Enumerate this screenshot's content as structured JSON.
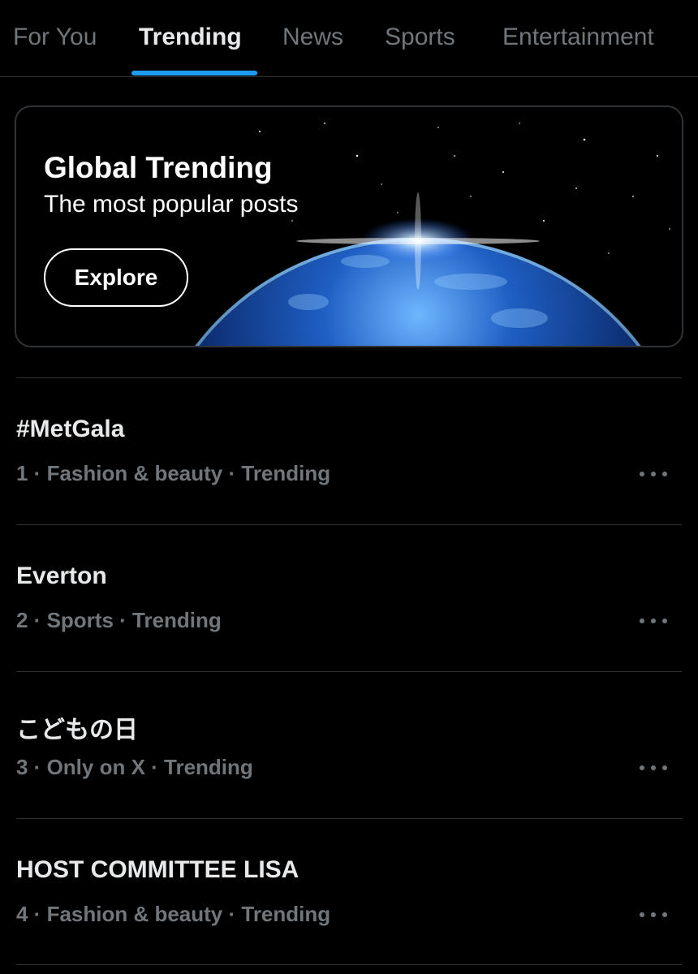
{
  "tabs": [
    {
      "label": "For You",
      "active": false
    },
    {
      "label": "Trending",
      "active": true
    },
    {
      "label": "News",
      "active": false
    },
    {
      "label": "Sports",
      "active": false
    },
    {
      "label": "Entertainment",
      "active": false
    }
  ],
  "banner": {
    "title": "Global Trending",
    "subtitle": "The most popular posts",
    "button_label": "Explore",
    "image": "earth-from-space"
  },
  "trends": [
    {
      "title": "#MetGala",
      "meta": "1 · Fashion & beauty · Trending"
    },
    {
      "title": "Everton",
      "meta": "2 · Sports · Trending"
    },
    {
      "title": "こどもの日",
      "meta": "3 · Only on X · Trending"
    },
    {
      "title": "HOST COMMITTEE LISA",
      "meta": "4 · Fashion & beauty · Trending"
    }
  ],
  "colors": {
    "background": "#000000",
    "accent": "#1d9bf0",
    "secondary_text": "#71767b",
    "border": "#2f3336"
  }
}
